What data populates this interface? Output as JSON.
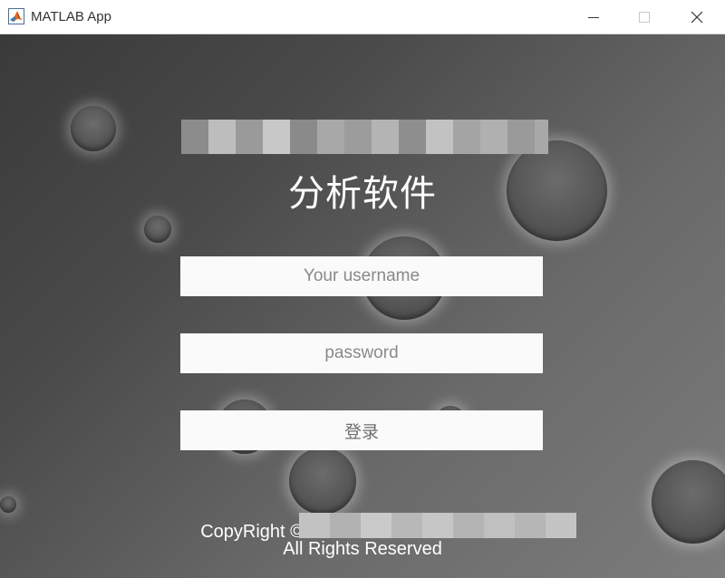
{
  "window": {
    "title": "MATLAB App",
    "minimize_label": "",
    "maximize_label": "",
    "close_label": ""
  },
  "icons": {
    "app": "matlab-logo-icon",
    "minimize": "minimize-icon",
    "maximize": "maximize-icon",
    "close": "close-icon"
  },
  "login": {
    "title": "分析软件",
    "username_placeholder": "Your username",
    "password_placeholder": "password",
    "login_button": "登录"
  },
  "footer": {
    "copyright_prefix": "CopyRight © 202",
    "rights": "All Rights Reserved"
  },
  "colors": {
    "background_dark": "#3a3a3a",
    "background_light": "#7c7c7c",
    "field_background": "#fafafa",
    "title_text": "#ffffff",
    "placeholder_text": "#8a8a8a"
  }
}
